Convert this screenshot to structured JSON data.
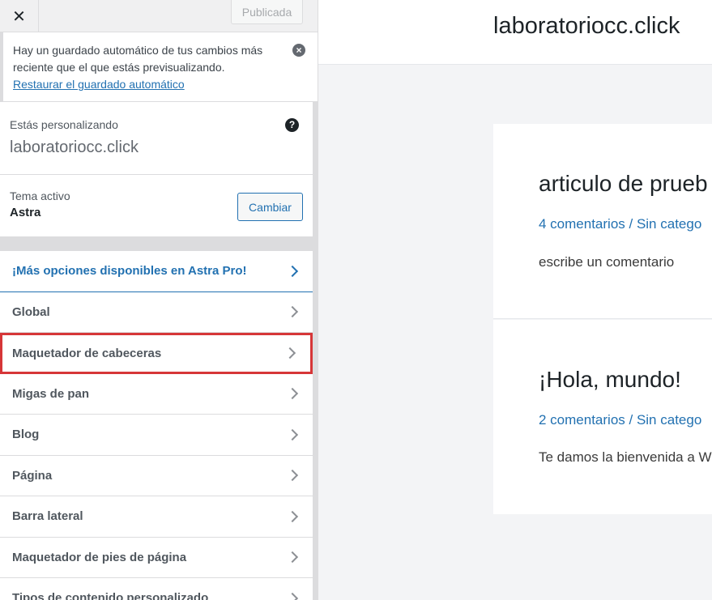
{
  "topbar": {
    "close_label": "✕",
    "publish_label": "Publicada"
  },
  "notice": {
    "text": "Hay un guardado automático de tus cambios más reciente que el que estás previsualizando.",
    "link": "Restaurar el guardado automático"
  },
  "info": {
    "label": "Estás personalizando",
    "site": "laboratoriocc.click"
  },
  "theme": {
    "label": "Tema activo",
    "name": "Astra",
    "change_label": "Cambiar"
  },
  "menu": {
    "items": [
      {
        "label": "¡Más opciones disponibles en Astra Pro!"
      },
      {
        "label": "Global"
      },
      {
        "label": "Maquetador de cabeceras"
      },
      {
        "label": "Migas de pan"
      },
      {
        "label": "Blog"
      },
      {
        "label": "Página"
      },
      {
        "label": "Barra lateral"
      },
      {
        "label": "Maquetador de pies de página"
      },
      {
        "label": "Tipos de contenido personalizado"
      }
    ]
  },
  "preview": {
    "site_title": "laboratoriocc.click",
    "posts": [
      {
        "title": "articulo de prueb",
        "meta": "4 comentarios / Sin catego",
        "excerpt": "escribe un comentario"
      },
      {
        "title": "¡Hola, mundo!",
        "meta": "2 comentarios / Sin catego",
        "excerpt": "Te damos la bienvenida a W"
      }
    ]
  },
  "colors": {
    "accent": "#2271b1",
    "highlight_border": "#d63638"
  }
}
